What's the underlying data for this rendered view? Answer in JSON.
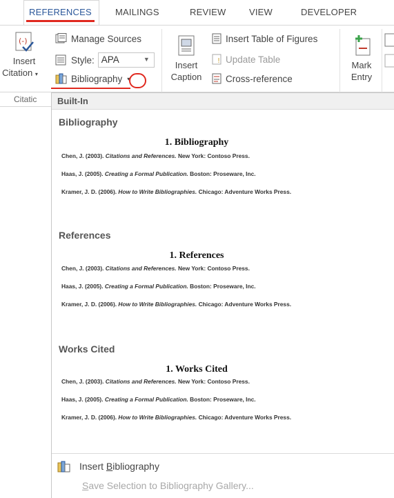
{
  "tabs": [
    "REFERENCES",
    "MAILINGS",
    "REVIEW",
    "VIEW",
    "DEVELOPER"
  ],
  "ribbon": {
    "insert_citation": [
      "Insert",
      "Citation"
    ],
    "manage_sources": "Manage Sources",
    "style_label": "Style:",
    "style_value": "APA",
    "bibliography": "Bibliography",
    "insert_caption": [
      "Insert",
      "Caption"
    ],
    "insert_table_of_figures": "Insert Table of Figures",
    "update_table": "Update Table",
    "cross_reference": "Cross-reference",
    "mark_entry": [
      "Mark",
      "Entry"
    ],
    "group_label": "Citatic"
  },
  "dropdown": {
    "header": "Built-In",
    "sections": [
      {
        "title": "Bibliography",
        "heading": "1. Bibliography",
        "entries": [
          {
            "pre": "Chen, J. (2003). ",
            "ital": "Citations and References.",
            "post": " New York: Contoso Press."
          },
          {
            "pre": "Haas, J. (2005). ",
            "ital": "Creating a Formal Publication.",
            "post": " Boston: Proseware, Inc."
          },
          {
            "pre": "Kramer, J. D. (2006). ",
            "ital": "How to Write Bibliographies.",
            "post": " Chicago: Adventure Works Press."
          }
        ]
      },
      {
        "title": "References",
        "heading": "1. References",
        "entries": [
          {
            "pre": "Chen, J. (2003). ",
            "ital": "Citations and References.",
            "post": " New York: Contoso Press."
          },
          {
            "pre": "Haas, J. (2005). ",
            "ital": "Creating a Formal Publication.",
            "post": " Boston: Proseware, Inc."
          },
          {
            "pre": "Kramer, J. D. (2006). ",
            "ital": "How to Write Bibliographies.",
            "post": " Chicago: Adventure Works Press."
          }
        ]
      },
      {
        "title": "Works Cited",
        "heading": "1. Works Cited",
        "entries": [
          {
            "pre": "Chen, J. (2003). ",
            "ital": "Citations and References.",
            "post": " New York: Contoso Press."
          },
          {
            "pre": "Haas, J. (2005). ",
            "ital": "Creating a Formal Publication.",
            "post": " Boston: Proseware, Inc."
          },
          {
            "pre": "Kramer, J. D. (2006). ",
            "ital": "How to Write Bibliographies.",
            "post": " Chicago: Adventure Works Press."
          }
        ]
      }
    ],
    "insert_bibliography": {
      "pre": "Insert ",
      "u": "B",
      "post": "ibliography"
    },
    "save_selection": {
      "u": "S",
      "post": "ave Selection to Bibliography Gallery..."
    }
  },
  "colors": {
    "accent": "#2b579a",
    "highlight_red": "#e0281e"
  }
}
